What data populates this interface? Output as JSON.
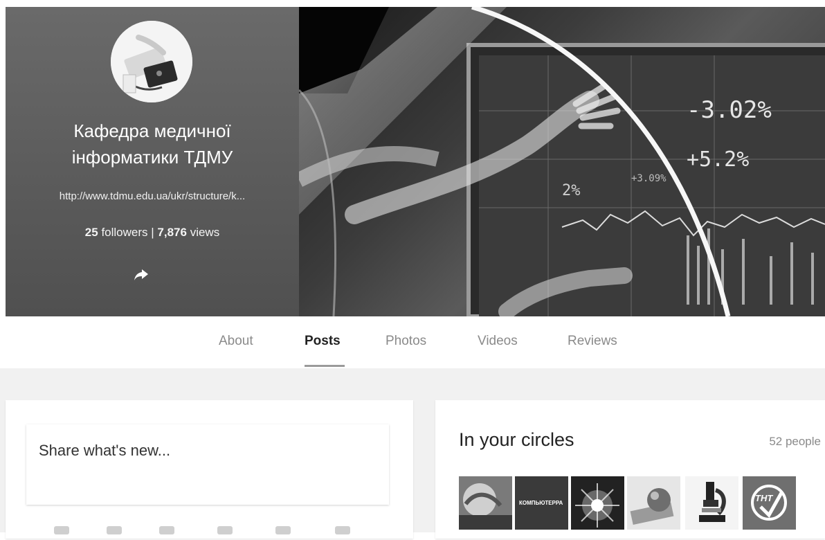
{
  "profile": {
    "name_line1": "Кафедра медичної",
    "name_line2": "інформатики ТДМУ",
    "url": "http://www.tdmu.edu.ua/ukr/structure/k...",
    "followers_count": "25",
    "followers_label": "followers",
    "views_count": "7,876",
    "views_label": "views"
  },
  "cover": {
    "readout_1": "-3.02%",
    "readout_2": "+5.2%",
    "readout_3": "+3.09%",
    "readout_4": "2%"
  },
  "tabs": [
    {
      "label": "About"
    },
    {
      "label": "Posts"
    },
    {
      "label": "Photos"
    },
    {
      "label": "Videos"
    },
    {
      "label": "Reviews"
    }
  ],
  "share": {
    "placeholder": "Share what's new..."
  },
  "circles": {
    "title": "In your circles",
    "count": "52 people",
    "thumb_2_text": "КОМПЬЮТЕРРА",
    "thumb_6_text": "ТНТ"
  },
  "colors": {
    "header_panel": "#5e5e5e",
    "background": "#f1f1f1",
    "active_tab": "#222222",
    "inactive_tab": "#8a8a8a"
  }
}
